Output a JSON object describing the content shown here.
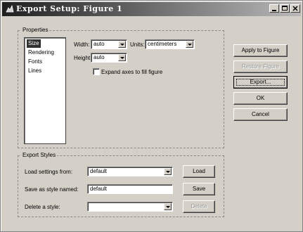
{
  "window": {
    "title": "Export Setup: Figure 1",
    "controls": [
      "minimize-icon",
      "maximize-icon",
      "close-icon"
    ]
  },
  "properties": {
    "group_label": "Properties",
    "list_items": [
      "Size",
      "Rendering",
      "Fonts",
      "Lines"
    ],
    "selected_item": "Size",
    "width_label": "Width:",
    "width_value": "auto",
    "units_label": "Units:",
    "units_value": "centimeters",
    "height_label": "Height:",
    "height_value": "auto",
    "expand_axes_label": "Expand axes to fill figure",
    "expand_axes_checked": false
  },
  "buttons": {
    "apply": "Apply to Figure",
    "restore": "Restore Figure",
    "export": "Export...",
    "ok": "OK",
    "cancel": "Cancel"
  },
  "export_styles": {
    "group_label": "Export Styles",
    "load_label": "Load settings from:",
    "load_value": "default",
    "load_button": "Load",
    "save_label": "Save as style named:",
    "save_value": "default",
    "save_button": "Save",
    "delete_label": "Delete a style:",
    "delete_value": "",
    "delete_button": "Delete"
  }
}
